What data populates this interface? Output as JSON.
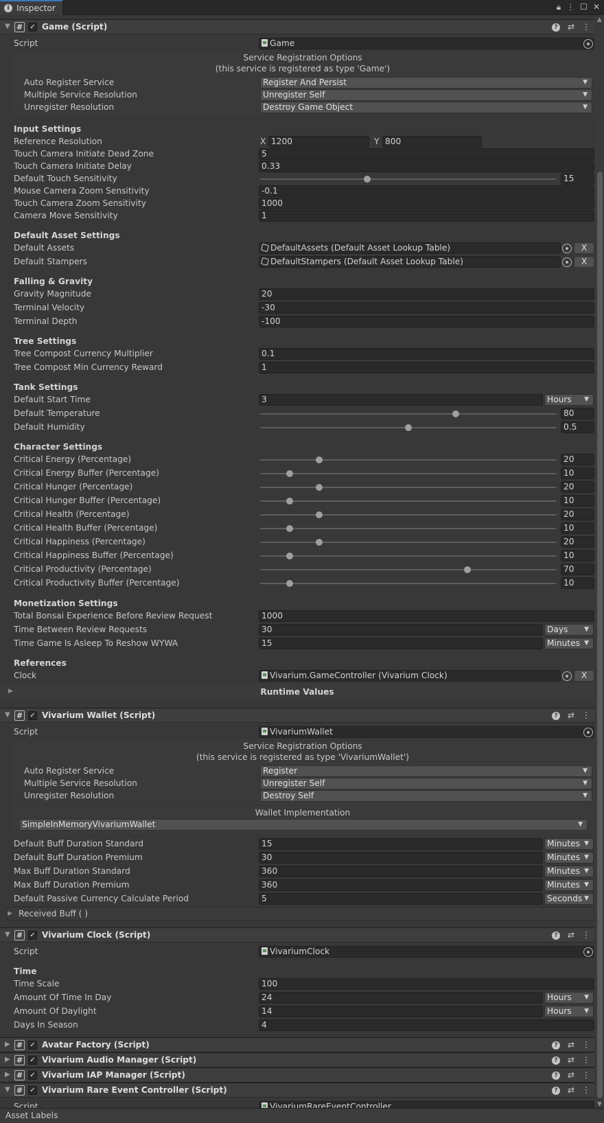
{
  "window": {
    "tab_title": "Inspector"
  },
  "game": {
    "title": "Game (Script)",
    "script_label": "Script",
    "script_value": "Game",
    "reg_title": "Service Registration Options",
    "reg_subtitle": "(this service is registered as type 'Game')",
    "auto_label": "Auto Register Service",
    "auto_value": "Register And Persist",
    "multi_label": "Multiple Service Resolution",
    "multi_value": "Unregister Self",
    "unreg_label": "Unregister Resolution",
    "unreg_value": "Destroy Game Object",
    "input_header": "Input Settings",
    "ref_res_label": "Reference Resolution",
    "x_label": "X",
    "x_value": "1200",
    "y_label": "Y",
    "y_value": "800",
    "tc_dead_label": "Touch Camera Initiate Dead Zone",
    "tc_dead_value": "5",
    "tc_delay_label": "Touch Camera Initiate Delay",
    "tc_delay_value": "0.33",
    "dts_label": "Default Touch Sensitivity",
    "dts_value": "15",
    "mczs_label": "Mouse Camera Zoom Sensitivity",
    "mczs_value": "-0.1",
    "tczs_label": "Touch Camera Zoom Sensitivity",
    "tczs_value": "1000",
    "cms_label": "Camera Move Sensitivity",
    "cms_value": "1",
    "asset_header": "Default Asset Settings",
    "da_label": "Default Assets",
    "da_value": "DefaultAssets (Default Asset Lookup Table)",
    "ds_label": "Default Stampers",
    "ds_value": "DefaultStampers (Default Asset Lookup Table)",
    "x_btn": "X",
    "fall_header": "Falling & Gravity",
    "gm_label": "Gravity Magnitude",
    "gm_value": "20",
    "tv_label": "Terminal Velocity",
    "tv_value": "-30",
    "td_label": "Terminal Depth",
    "td_value": "-100",
    "tree_header": "Tree Settings",
    "tccm_label": "Tree Compost Currency Multiplier",
    "tccm_value": "0.1",
    "tcmr_label": "Tree Compost Min Currency Reward",
    "tcmr_value": "1",
    "tank_header": "Tank Settings",
    "dst_label": "Default Start Time",
    "dst_value": "3",
    "dst_unit": "Hours",
    "dt_label": "Default Temperature",
    "dt_value": "80",
    "dh_label": "Default Humidity",
    "dh_value": "0.5",
    "char_header": "Character Settings",
    "ce_label": "Critical Energy (Percentage)",
    "ce_value": "20",
    "ceb_label": "Critical Energy Buffer (Percentage)",
    "ceb_value": "10",
    "chu_label": "Critical Hunger (Percentage)",
    "chu_value": "20",
    "chub_label": "Critical Hunger Buffer (Percentage)",
    "chub_value": "10",
    "che_label": "Critical Health (Percentage)",
    "che_value": "20",
    "cheb_label": "Critical Health Buffer (Percentage)",
    "cheb_value": "10",
    "cha_label": "Critical Happiness (Percentage)",
    "cha_value": "20",
    "chab_label": "Critical Happiness Buffer (Percentage)",
    "chab_value": "10",
    "cp_label": "Critical Productivity (Percentage)",
    "cp_value": "70",
    "cpb_label": "Critical Productivity Buffer (Percentage)",
    "cpb_value": "10",
    "mon_header": "Monetization Settings",
    "tbe_label": "Total Bonsai Experience Before Review Request",
    "tbe_value": "1000",
    "tbr_label": "Time Between Review Requests",
    "tbr_value": "30",
    "tbr_unit": "Days",
    "tga_label": "Time Game Is Asleep To Reshow WYWA",
    "tga_value": "15",
    "tga_unit": "Minutes",
    "refs_header": "References",
    "clock_label": "Clock",
    "clock_value": "Vivarium.GameController (Vivarium Clock)",
    "runtime_label": "Runtime Values"
  },
  "wallet": {
    "title": "Vivarium Wallet (Script)",
    "script_label": "Script",
    "script_value": "VivariumWallet",
    "reg_title": "Service Registration Options",
    "reg_subtitle": "(this service is registered as type 'VivariumWallet')",
    "auto_label": "Auto Register Service",
    "auto_value": "Register",
    "multi_label": "Multiple Service Resolution",
    "multi_value": "Unregister Self",
    "unreg_label": "Unregister Resolution",
    "unreg_value": "Destroy Self",
    "impl_title": "Wallet Implementation",
    "impl_value": "SimpleInMemoryVivariumWallet",
    "dbs_label": "Default Buff Duration Standard",
    "dbs_value": "15",
    "dbs_unit": "Minutes",
    "dbp_label": "Default Buff Duration Premium",
    "dbp_value": "30",
    "dbp_unit": "Minutes",
    "mbs_label": "Max Buff Duration Standard",
    "mbs_value": "360",
    "mbs_unit": "Minutes",
    "mbp_label": "Max Buff Duration Premium",
    "mbp_value": "360",
    "mbp_unit": "Minutes",
    "dpc_label": "Default Passive Currency Calculate Period",
    "dpc_value": "5",
    "dpc_unit": "Seconds",
    "rb_label": "Received Buff ( )"
  },
  "clock": {
    "title": "Vivarium Clock (Script)",
    "script_label": "Script",
    "script_value": "VivariumClock",
    "time_header": "Time",
    "ts_label": "Time Scale",
    "ts_value": "100",
    "atd_label": "Amount Of Time In Day",
    "atd_value": "24",
    "atd_unit": "Hours",
    "ad_label": "Amount Of Daylight",
    "ad_value": "14",
    "ad_unit": "Hours",
    "dis_label": "Days In Season",
    "dis_value": "4"
  },
  "collapsed": {
    "avatar": "Avatar Factory (Script)",
    "audio": "Vivarium Audio Manager (Script)",
    "iap": "Vivarium IAP Manager (Script)"
  },
  "rare": {
    "title": "Vivarium Rare Event Controller (Script)",
    "script_label": "Script",
    "script_value": "VivariumRareEventController"
  },
  "footer": {
    "label": "Asset Labels"
  },
  "sliders": {
    "dts": 0.36,
    "dt": 0.66,
    "dh": 0.5,
    "ce": 0.2,
    "ceb": 0.1,
    "chu": 0.2,
    "chub": 0.1,
    "che": 0.2,
    "cheb": 0.1,
    "cha": 0.2,
    "chab": 0.1,
    "cp": 0.7,
    "cpb": 0.1
  },
  "colors": {
    "accent": "#3a79bb",
    "panel": "#383838",
    "header": "#3e3e3e",
    "field": "#2a2a2a"
  }
}
